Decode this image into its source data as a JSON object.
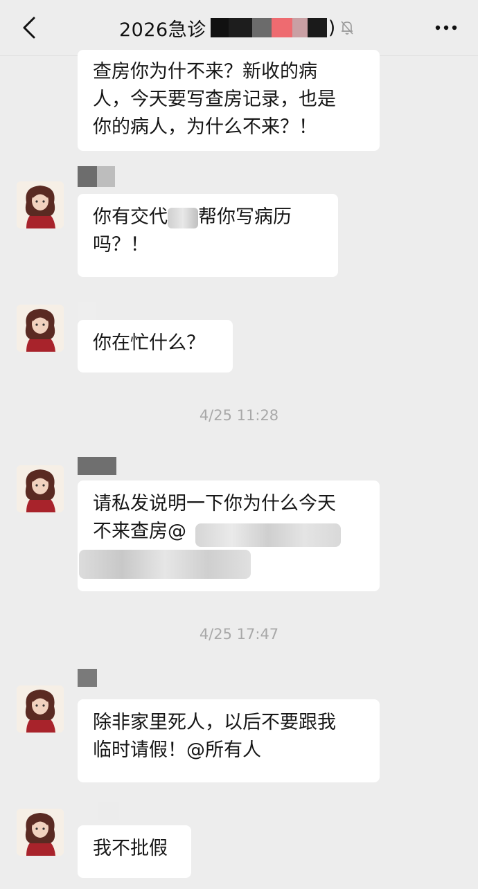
{
  "header": {
    "title": "2026急诊",
    "title_suffix": ")",
    "back_icon": "chevron-left-icon",
    "mute_icon": "bell-off-icon",
    "more_icon": "more-dots-icon"
  },
  "messages": [
    {
      "lines": [
        "查房你为什不来？新收的病",
        "人，今天要写查房记录，也是",
        "你的病人，为什么不来？！"
      ]
    },
    {
      "lines": [
        "你有交代",
        "帮你写病历",
        "吗？！"
      ]
    },
    {
      "lines": [
        "你在忙什么？"
      ]
    },
    {
      "timestamp": "4/25 11:28"
    },
    {
      "lines": [
        "请私发说明一下你为什么今天",
        "不来查房@"
      ]
    },
    {
      "timestamp": "4/25 17:47"
    },
    {
      "lines": [
        "除非家里死人，以后不要跟我",
        "临时请假！@所有人"
      ]
    },
    {
      "lines": [
        "我不批假"
      ]
    }
  ],
  "colors": {
    "background": "#ededed",
    "bubble": "#ffffff",
    "text": "#161616",
    "timestamp": "#a8a8a8",
    "avatar_red": "#a8232b"
  }
}
